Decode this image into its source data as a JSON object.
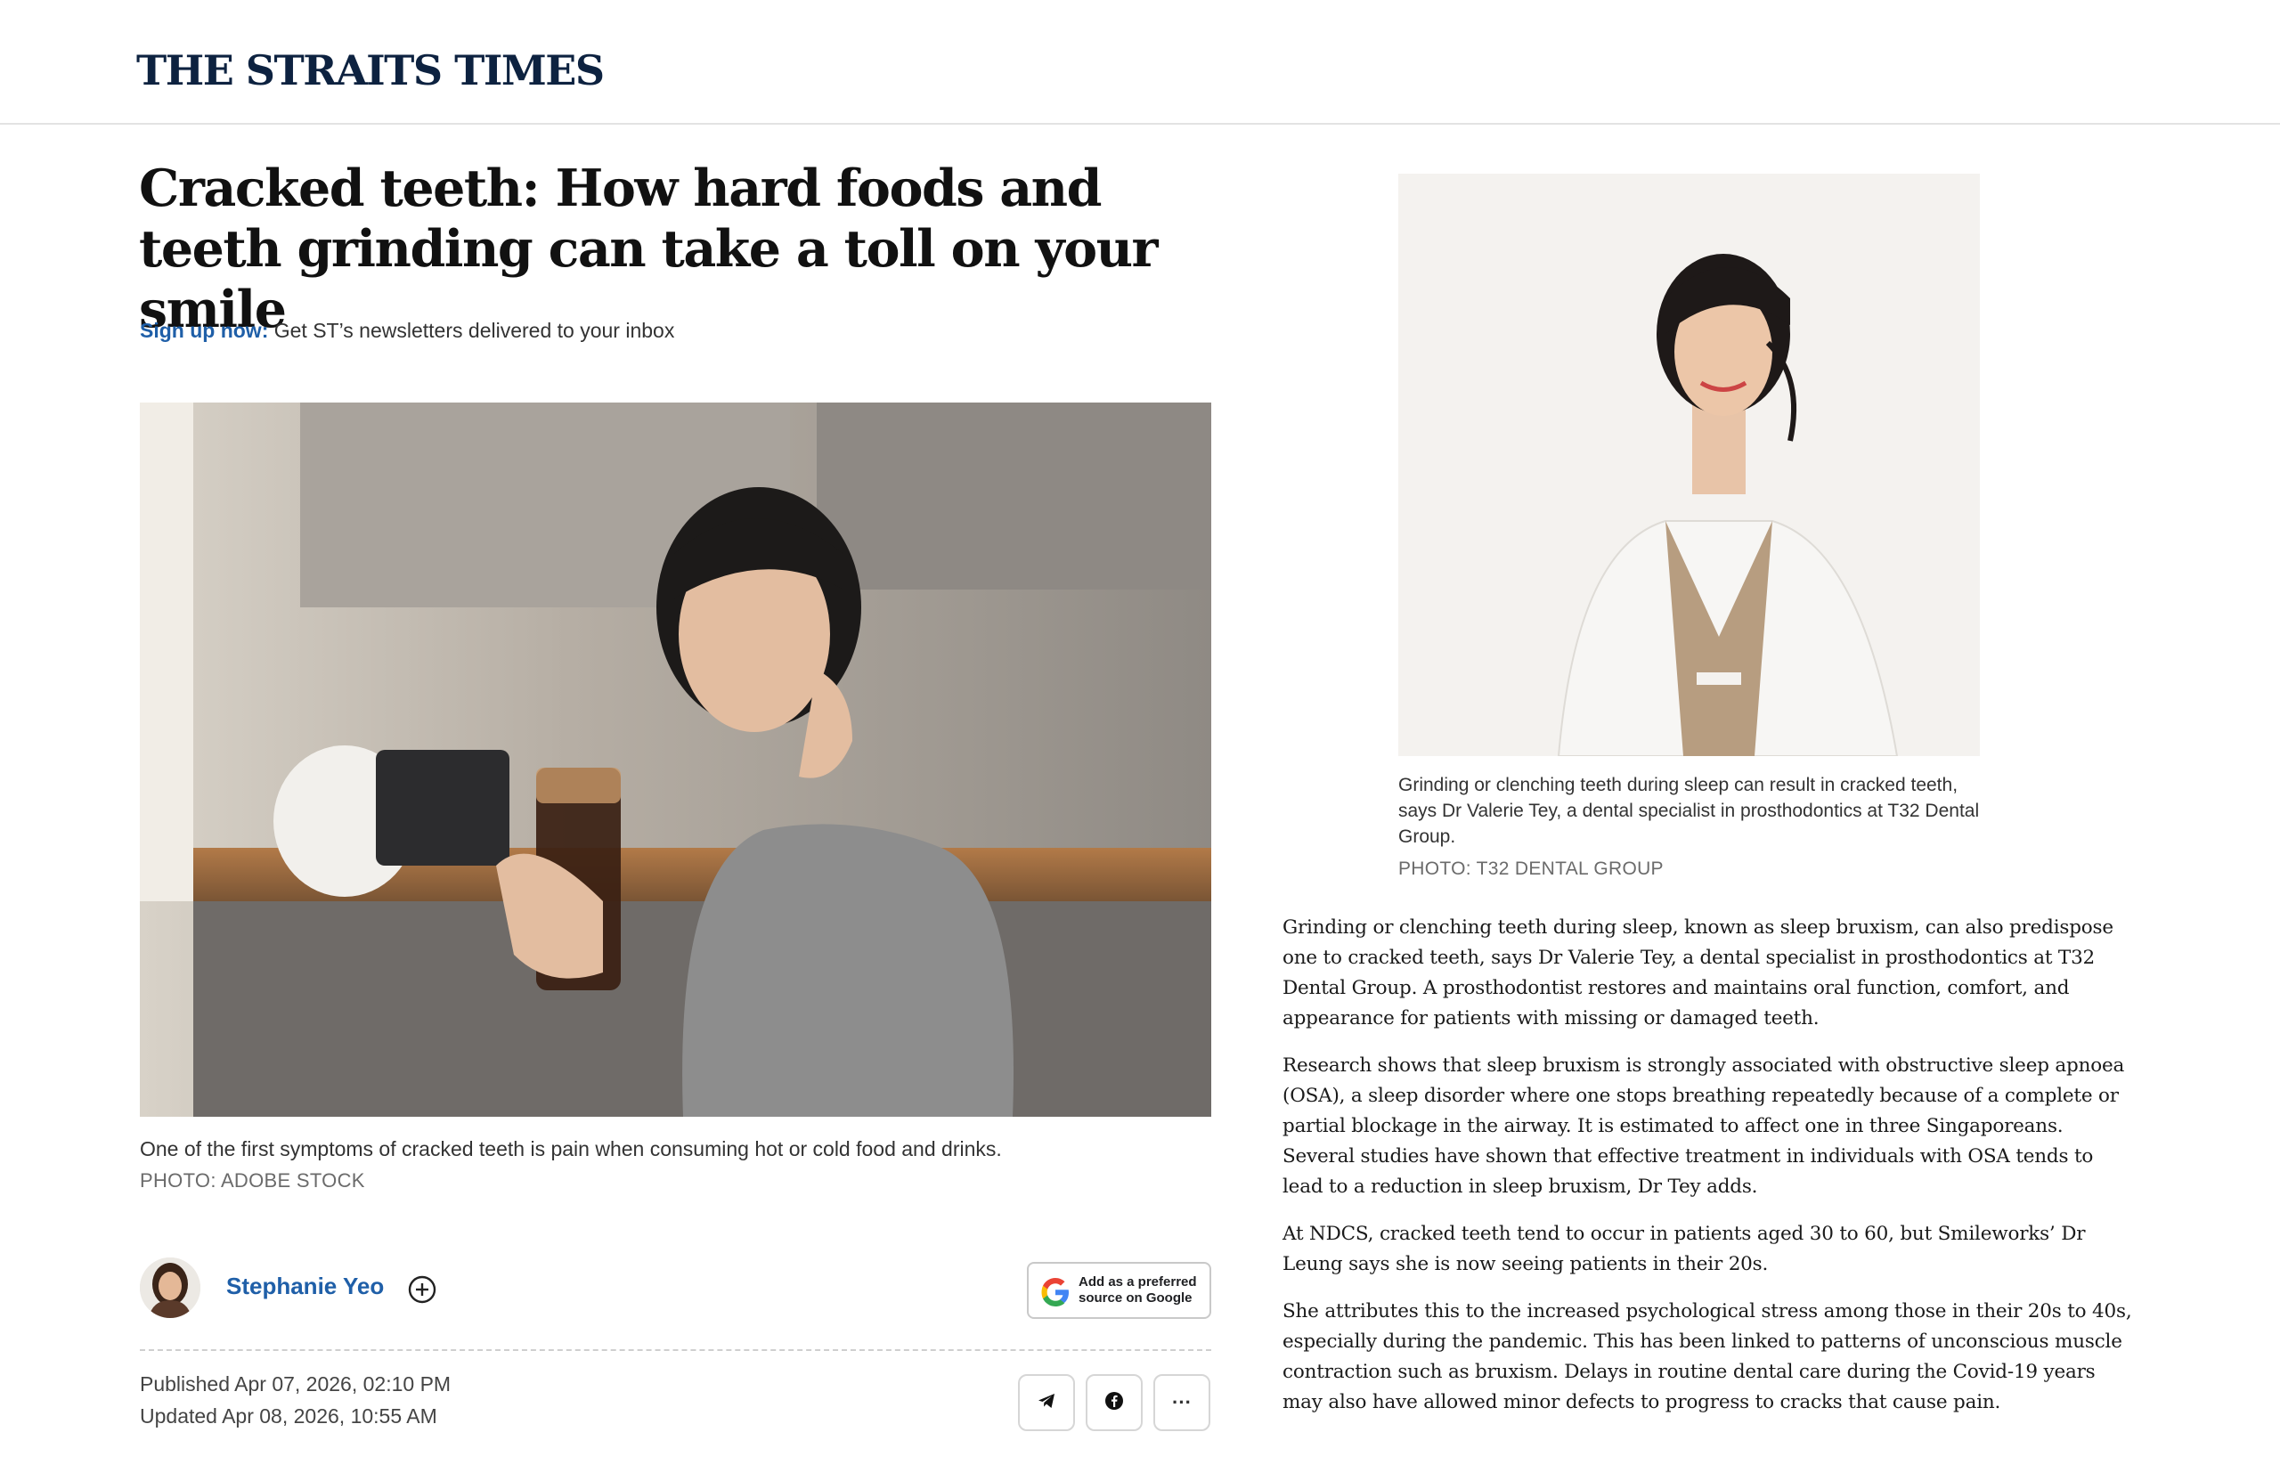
{
  "header": {
    "logo": "THE STRAITS TIMES"
  },
  "article": {
    "headline": "Cracked teeth: How hard foods and teeth grinding can take a toll on your smile",
    "signup_link": "Sign up now:",
    "signup_text": " Get ST’s newsletters delivered to your inbox",
    "hero_caption": "One of the first symptoms of cracked teeth is pain when consuming hot or cold food and drinks.",
    "hero_credit": "PHOTO: ADOBE STOCK",
    "author": "Stephanie Yeo",
    "google_button": [
      "Add as a preferred",
      "source on Google"
    ],
    "published": "Published Apr 07, 2026, 02:10 PM",
    "updated": "Updated Apr 08, 2026, 10:55 AM",
    "share_more": "···",
    "side_caption": "Grinding or clenching teeth during sleep can result in cracked teeth, says Dr Valerie Tey, a dental specialist in prosthodontics at T32 Dental Group.",
    "side_credit": "PHOTO: T32 DENTAL GROUP",
    "paragraphs": [
      "Grinding or clenching teeth during sleep, known as sleep bruxism, can also predispose one to cracked teeth, says Dr Valerie Tey, a dental specialist in prosthodontics at T32 Dental Group. A prosthodontist restores and maintains oral function, comfort, and appearance for patients with missing or damaged teeth.",
      "Research shows that sleep bruxism is strongly associated with obstructive sleep apnoea (OSA), a sleep disorder where one stops breathing repeatedly because of a complete or partial blockage in the airway. It is estimated to affect one in three Singaporeans. Several studies have shown that effective treatment in individuals with OSA tends to lead to a reduction in sleep bruxism, Dr Tey adds.",
      "At NDCS, cracked teeth tend to occur in patients aged 30 to 60, but Smileworks’ Dr Leung says she is now seeing patients in their 20s.",
      "She attributes this to the increased psychological stress among those in their 20s to 40s, especially during the pandemic. This has been linked to patterns of unconscious muscle contraction such as bruxism. Delays in routine dental care during the Covid-19 years may also have allowed minor defects to progress to cracks that cause pain."
    ]
  },
  "icons": {
    "follow": "plus-circle-icon",
    "google": "google-g-icon",
    "telegram": "telegram-icon",
    "facebook": "facebook-icon"
  },
  "colors": {
    "brand_navy": "#0d2240",
    "link_blue": "#1f5fa8"
  }
}
